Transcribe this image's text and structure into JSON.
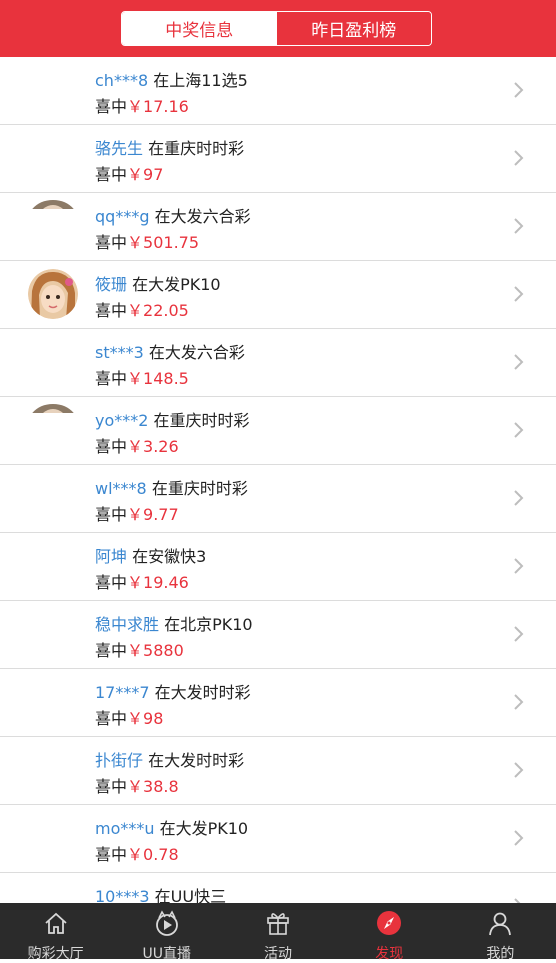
{
  "header": {
    "tabs": [
      {
        "label": "中奖信息",
        "active": true
      },
      {
        "label": "昨日盈利榜",
        "active": false
      }
    ]
  },
  "win_prefix": "喜中",
  "currency": "￥",
  "rows": [
    {
      "name": "ch***8",
      "game": "在上海11选5",
      "amount": "17.16",
      "avatar": "none"
    },
    {
      "name": "骆先生",
      "game": "在重庆时时彩",
      "amount": "97",
      "avatar": "none"
    },
    {
      "name": "qq***g",
      "game": "在大发六合彩",
      "amount": "501.75",
      "avatar": "partial"
    },
    {
      "name": "筱珊",
      "game": "在大发PK10",
      "amount": "22.05",
      "avatar": "photo"
    },
    {
      "name": "st***3",
      "game": "在大发六合彩",
      "amount": "148.5",
      "avatar": "none"
    },
    {
      "name": "yo***2",
      "game": "在重庆时时彩",
      "amount": "3.26",
      "avatar": "partial"
    },
    {
      "name": "wl***8",
      "game": "在重庆时时彩",
      "amount": "9.77",
      "avatar": "none"
    },
    {
      "name": "阿坤",
      "game": "在安徽快3",
      "amount": "19.46",
      "avatar": "none"
    },
    {
      "name": "稳中求胜",
      "game": "在北京PK10",
      "amount": "5880",
      "avatar": "none"
    },
    {
      "name": "17***7",
      "game": "在大发时时彩",
      "amount": "98",
      "avatar": "none"
    },
    {
      "name": "扑街仔",
      "game": "在大发时时彩",
      "amount": "38.8",
      "avatar": "none"
    },
    {
      "name": "mo***u",
      "game": "在大发PK10",
      "amount": "0.78",
      "avatar": "none"
    },
    {
      "name": "10***3",
      "game": "在UU快三",
      "amount": "",
      "avatar": "none"
    }
  ],
  "tabbar": [
    {
      "label": "购彩大厅",
      "icon": "home-icon",
      "active": false
    },
    {
      "label": "UU直播",
      "icon": "live-play-icon",
      "active": false
    },
    {
      "label": "活动",
      "icon": "gift-icon",
      "active": false
    },
    {
      "label": "发现",
      "icon": "compass-icon",
      "active": true
    },
    {
      "label": "我的",
      "icon": "user-icon",
      "active": false
    }
  ],
  "colors": {
    "brand": "#e8333d",
    "name": "#3b87d0",
    "tabbar_bg": "#2b2b2b"
  }
}
